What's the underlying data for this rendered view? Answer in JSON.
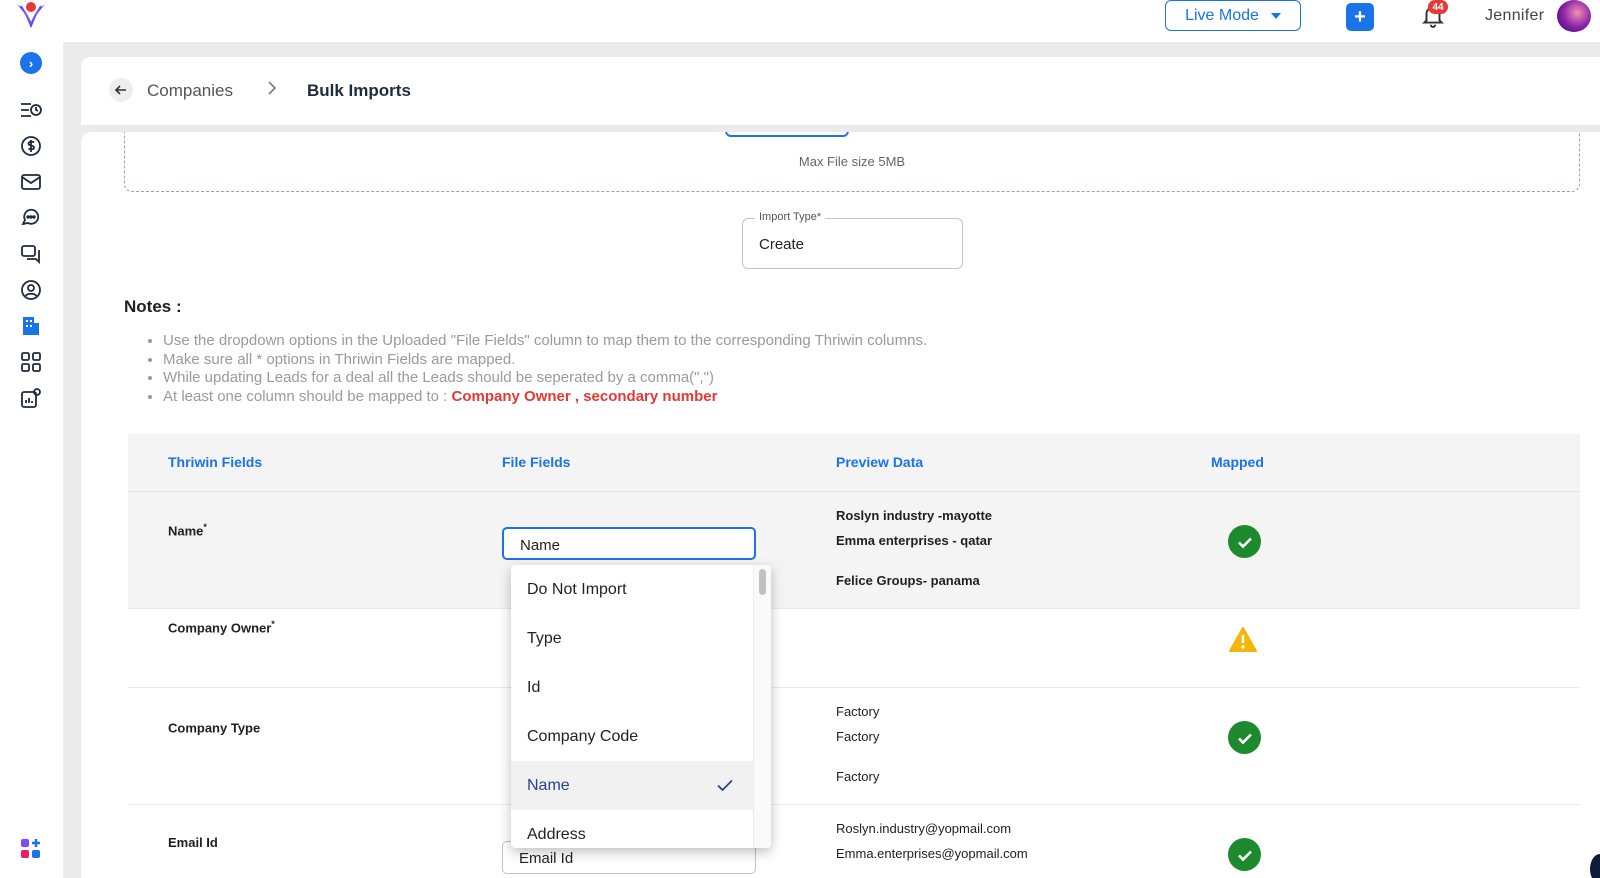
{
  "topbar": {
    "mode_label": "Live Mode",
    "add_label": "+",
    "notification_count": "44",
    "username": "Jennifer"
  },
  "breadcrumb": {
    "parent": "Companies",
    "separator": ">",
    "current": "Bulk Imports"
  },
  "upload": {
    "max_size": "Max File size 5MB"
  },
  "import_type": {
    "label": "Import Type*",
    "value": "Create"
  },
  "notes": {
    "title": "Notes :",
    "items": [
      "Use the dropdown options in the Uploaded \"File Fields\" column to map them to the corresponding Thriwin columns.",
      "Make sure all * options in Thriwin Fields are mapped.",
      "While updating Leads for a deal all the Leads should be seperated by a comma(\",\")",
      "At least one column should be mapped to : "
    ],
    "highlight": "Company Owner , secondary number"
  },
  "table": {
    "headers": [
      "Thriwin Fields",
      "File Fields",
      "Preview Data",
      "Mapped"
    ],
    "rows": [
      {
        "field": "Name",
        "required": "*",
        "file_field": "Name",
        "preview": [
          "Roslyn industry -mayotte",
          "Emma enterprises - qatar",
          "",
          "Felice Groups- panama"
        ],
        "status": "ok"
      },
      {
        "field": "Company Owner",
        "required": "*",
        "file_field": "",
        "preview": [],
        "status": "warning"
      },
      {
        "field": "Company Type",
        "required": "",
        "file_field": "",
        "preview": [
          "Factory",
          "Factory",
          "",
          "Factory"
        ],
        "status": "ok"
      },
      {
        "field": "Email Id",
        "required": "",
        "file_field": "Email Id",
        "preview": [
          "Roslyn.industry@yopmail.com",
          "Emma.enterprises@yopmail.com"
        ],
        "status": "ok"
      }
    ]
  },
  "dropdown": {
    "options": [
      "Do Not Import",
      "Type",
      "Id",
      "Company Code",
      "Name",
      "Address"
    ],
    "selected": "Name"
  },
  "colors": {
    "accent": "#1a73e8",
    "success": "#1e8a2e",
    "warning": "#f5b50a",
    "danger": "#e53935"
  }
}
